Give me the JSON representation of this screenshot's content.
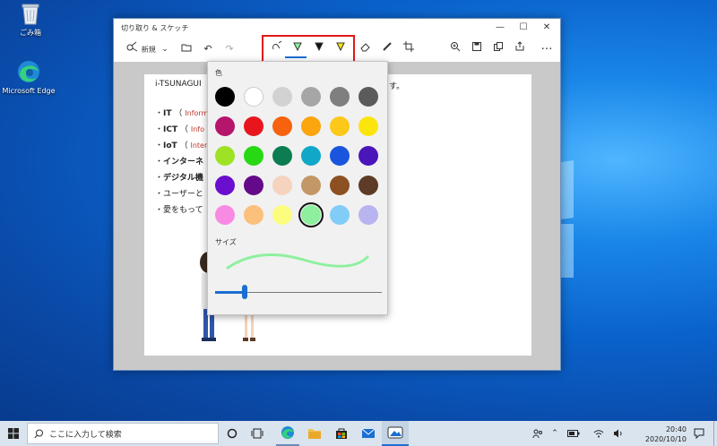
{
  "desktop": {
    "icons": [
      {
        "label": "ごみ箱",
        "icon": "recycle-bin-icon"
      },
      {
        "label": "Microsoft Edge",
        "icon": "edge-icon"
      }
    ]
  },
  "window": {
    "title": "切り取り & スケッチ",
    "controls": [
      "—",
      "☐",
      "✕"
    ]
  },
  "toolbar": {
    "new_label": "新規",
    "more_label": "…"
  },
  "document": {
    "first_line_left": "i-TSUNAGUI",
    "first_line_right": "ます。",
    "items": [
      {
        "bullet": "・",
        "bold": "IT",
        "paren": "（",
        "note": "Inform"
      },
      {
        "bullet": "・",
        "bold": "ICT",
        "paren": "（",
        "note": "Info"
      },
      {
        "bullet": "・",
        "bold": "IoT",
        "paren": "（",
        "note": "Inter"
      },
      {
        "bullet": "・",
        "bold": "インターネ",
        "paren": "",
        "note": ""
      },
      {
        "bullet": "・",
        "bold": "デジタル機",
        "paren": "",
        "note": ""
      },
      {
        "bullet": "・",
        "bold": "",
        "paren": "",
        "note": "ユーザーと"
      },
      {
        "bullet": "・",
        "bold": "",
        "paren": "",
        "note": "愛をもって"
      }
    ]
  },
  "color_panel": {
    "color_heading": "色",
    "size_heading": "サイズ",
    "colors": [
      "#000000",
      "#ffffff",
      "#d2d2d2",
      "#a6a6a6",
      "#7f7f7f",
      "#5b5b5b",
      "#b5166c",
      "#e8161c",
      "#f7620e",
      "#fba50f",
      "#fcc81a",
      "#fce50e",
      "#9ee226",
      "#27d915",
      "#0b7d51",
      "#10a7c8",
      "#1a55de",
      "#4b16b9",
      "#6b0fce",
      "#640989",
      "#f6d3bf",
      "#c39766",
      "#8d5021",
      "#5e3b26",
      "#f98ae4",
      "#fcc07d",
      "#fcfc7f",
      "#8ef09f",
      "#82cdf7",
      "#b8b4ef"
    ],
    "selected_color": "#8ef09f",
    "size_value": 0.18
  },
  "taskbar": {
    "search_placeholder": "ここに入力して検索",
    "time": "20:40",
    "date": "2020/10/10"
  }
}
